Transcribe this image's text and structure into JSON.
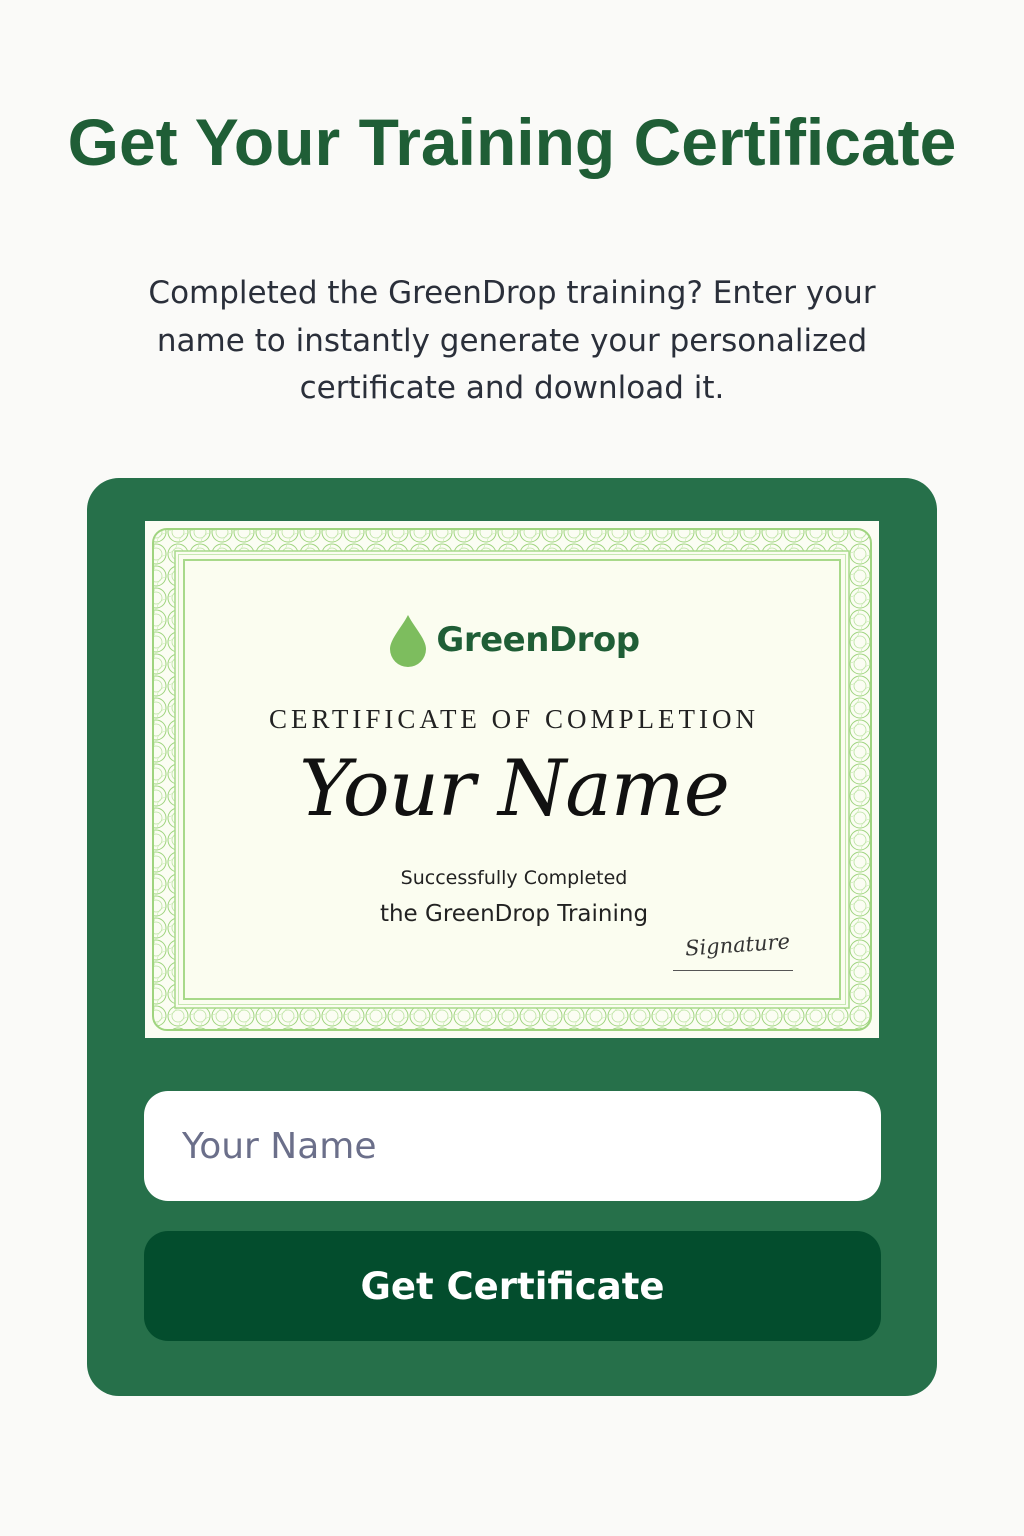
{
  "header": {
    "title": "Get Your Training Certificate",
    "description": "Completed the GreenDrop training? Enter your name to instantly generate your personalized certificate and download it."
  },
  "certificate": {
    "brand_name": "GreenDrop",
    "heading": "Certificate of Completion",
    "recipient_name": "Your Name",
    "completion_line": "Successfully Completed",
    "course_line": "the GreenDrop Training",
    "signature": "Signature"
  },
  "form": {
    "name_placeholder": "Your Name",
    "name_value": "",
    "submit_label": "Get Certificate"
  },
  "colors": {
    "title_green": "#1f5e36",
    "card_green": "#26704a",
    "button_green": "#034d2d",
    "border_light_green": "#a8d98a",
    "drop_green": "#7dbd5e"
  },
  "icons": {
    "brand_icon": "water-drop-icon"
  }
}
